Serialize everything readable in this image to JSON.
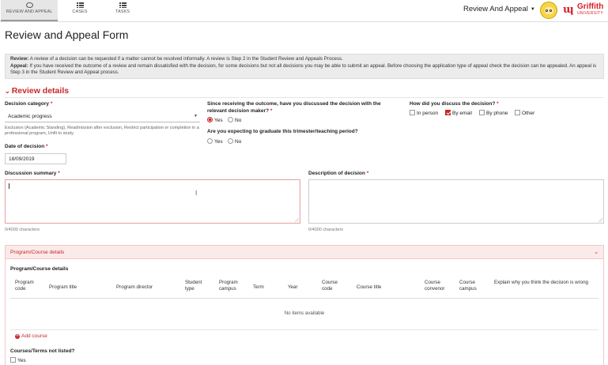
{
  "nav": {
    "tabs": [
      {
        "label": "REVIEW AND APPEAL",
        "icon": "gavel-icon",
        "active": true
      },
      {
        "label": "CASES",
        "icon": "list-icon",
        "active": false
      },
      {
        "label": "TASKS",
        "icon": "list-icon",
        "active": false
      }
    ],
    "app_menu": "Review And Appeal",
    "logo_name": "Griffith",
    "logo_sub": "UNIVERSITY"
  },
  "page_title": "Review and Appeal Form",
  "info": {
    "review_label": "Review:",
    "review_text": " A review of a decision can be requested if a matter cannot be resolved informally. A review is Step 2 in the Student Review and Appeals Process.",
    "appeal_label": "Appeal:",
    "appeal_text": " If you have received the outcome of a review and remain dissatisfied with the decision, for some decisions but not all decisions you may be able to submit an appeal. Before choosing the  application type of appeal check the decision can be appealed. An appeal is Step 3 in the Student Review and Appeal process."
  },
  "section": {
    "title": "Review details",
    "decision_category_label": "Decision category",
    "decision_category_value": "Academic progress",
    "decision_category_help": "Exclusion (Academic Standing), Readmission after exclusion, Restrict participation or completion in a professional program, Unfit to study.",
    "date_label": "Date of decision",
    "date_value": "18/09/2019",
    "discussed_label": "Since receiving the outcome, have you discussed the decision with the relevant decision maker?",
    "discussed_yes": "Yes",
    "discussed_no": "No",
    "graduate_label": "Are you expecting to graduate this trimester/teaching period?",
    "graduate_yes": "Yes",
    "graduate_no": "No",
    "how_label": "How did you discuss the decision?",
    "how_options": [
      "In person",
      "By email",
      "By phone",
      "Other"
    ],
    "how_selected": "By email",
    "summary_label": "Discussion summary",
    "summary_count": "0/4000 characters",
    "description_label": "Description of decision",
    "description_count": "0/4000 characters",
    "required_mark": "*"
  },
  "program_panel": {
    "header": "Program/Course details",
    "subtitle": "Program/Course details",
    "columns": [
      "Program code",
      "Program title",
      "Program director",
      "Student type",
      "Program campus",
      "Term",
      "Year",
      "Course code",
      "Course title",
      "Course convenor",
      "Course campus",
      "Explain why you think the decision is wrong"
    ],
    "empty_text": "No items available",
    "add_course": "Add course",
    "not_listed_label": "Courses/Terms not listed?",
    "not_listed_yes": "Yes"
  },
  "colors": {
    "accent": "#c62828",
    "info_bg": "#ececec",
    "panel_bg": "#fbeaea"
  }
}
